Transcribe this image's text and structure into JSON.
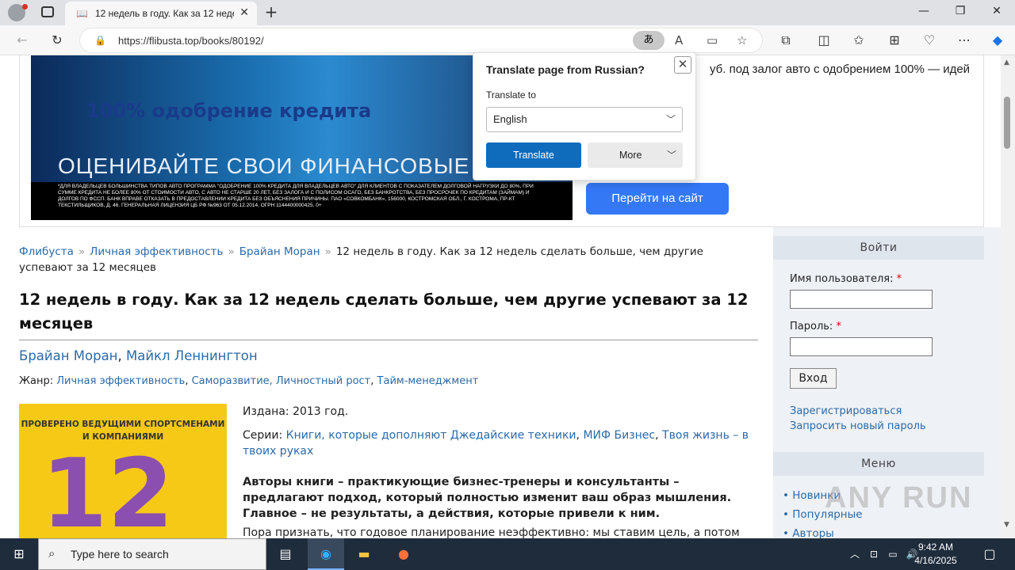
{
  "browser": {
    "tab_title": "12 недель в году. Как за 12 неде",
    "url": "https://flibusta.top/books/80192/",
    "translate_pill": "あ",
    "new_tab": "+",
    "tab_close": "✕",
    "minimize": "—",
    "maximize": "❐",
    "close": "✕"
  },
  "ad": {
    "headline": "100% одобрение кредита",
    "sub": "ОЦЕНИВАЙТЕ СВОИ ФИНАНСОВЫЕ ВОЗМОЖНОСТИ",
    "fine_print": "*ДЛЯ ВЛАДЕЛЬЦЕВ БОЛЬШИНСТВА ТИПОВ АВТО ПРОГРАММА \"ОДОБРЕНИЕ 100% КРЕДИТА ДЛЯ ВЛАДЕЛЬЦЕВ АВТО\" ДЛЯ КЛИЕНТОВ С ПОКАЗАТЕЛЕМ ДОЛГОВОЙ НАГРУЗКИ ДО 80%, ПРИ СУММЕ КРЕДИТА НЕ БОЛЕЕ 80% ОТ СТОИМОСТИ АВТО, С АВТО НЕ СТАРШЕ 20 ЛЕТ, БЕЗ ЗАЛОГА И С ПОЛИСОМ ОСАГО, БЕЗ БАНКРОТСТВА, БЕЗ ПРОСРОЧЕК ПО КРЕДИТАМ (ЗАЙМАМ) И ДОЛГОВ ПО ФССП. БАНК ВПРАВЕ ОТКАЗАТЬ В ПРЕДОСТАВЛЕНИИ КРЕДИТА БЕЗ ОБЪЯСНЕНИЯ ПРИЧИНЫ. ПАО «СОВКОМБАНК», 156000, КОСТРОМСКАЯ ОБЛ., Г. КОСТРОМА, ПР-КТ ТЕКСТИЛЬЩИКОВ, Д. 46. ГЕНЕРАЛЬНАЯ ЛИЦЕНЗИЯ ЦБ РФ №963 ОТ 05.12.2014, ОГРН 1144400000425. 0+",
    "side_text": "уб. под залог авто с одобрением 100% — идей",
    "button": "Перейти на сайт"
  },
  "translate_popup": {
    "title": "Translate page from Russian?",
    "label": "Translate to",
    "selected": "English",
    "translate_btn": "Translate",
    "more_btn": "More"
  },
  "breadcrumb": {
    "items": [
      "Флибуста",
      "Личная эффективность",
      "Брайан Моран"
    ],
    "separator": "»",
    "current": "12 недель в году. Как за 12 недель сделать больше, чем другие успевают за 12 месяцев"
  },
  "book": {
    "title": "12 недель в году. Как за 12 недель сделать больше, чем другие успевают за 12 месяцев",
    "authors": [
      "Брайан Моран",
      "Майкл Леннингтон"
    ],
    "genre_label": "Жанр:",
    "genres": [
      "Личная эффективность",
      "Саморазвитие, Личностный рост",
      "Тайм-менеджмент"
    ],
    "published": "Издана: 2013 год.",
    "series_label": "Серии:",
    "series": [
      "Книги, которые дополняют Джедайские техники",
      "МИФ Бизнес",
      "Твоя жизнь – в твоих руках"
    ],
    "annotation": "Авторы книги – практикующие бизнес-тренеры и консультанты – предлагают подход, который полностью изменит ваш образ мышления. Главное – не результаты, а действия, которые привели к ним.",
    "annotation_cut": "Пора признать, что годовое планирование неэффективно: мы ставим цель, а потом",
    "cover_tagline": "ПРОВЕРЕНО ВЕДУЩИМИ СПОРТСМЕНАМИ И КОМПАНИЯМИ",
    "cover_number": "12"
  },
  "sidebar": {
    "login_header": "Войти",
    "username_label": "Имя пользователя:",
    "password_label": "Пароль:",
    "required": "*",
    "login_button": "Вход",
    "register_link": "Зарегистрироваться",
    "reset_link": "Запросить новый пароль",
    "menu_header": "Меню",
    "menu_items": [
      "Новинки",
      "Популярные",
      "Авторы"
    ]
  },
  "taskbar": {
    "search_placeholder": "Type here to search",
    "time": "9:42 AM",
    "date": "4/16/2025"
  },
  "watermark": "ANY RUN"
}
